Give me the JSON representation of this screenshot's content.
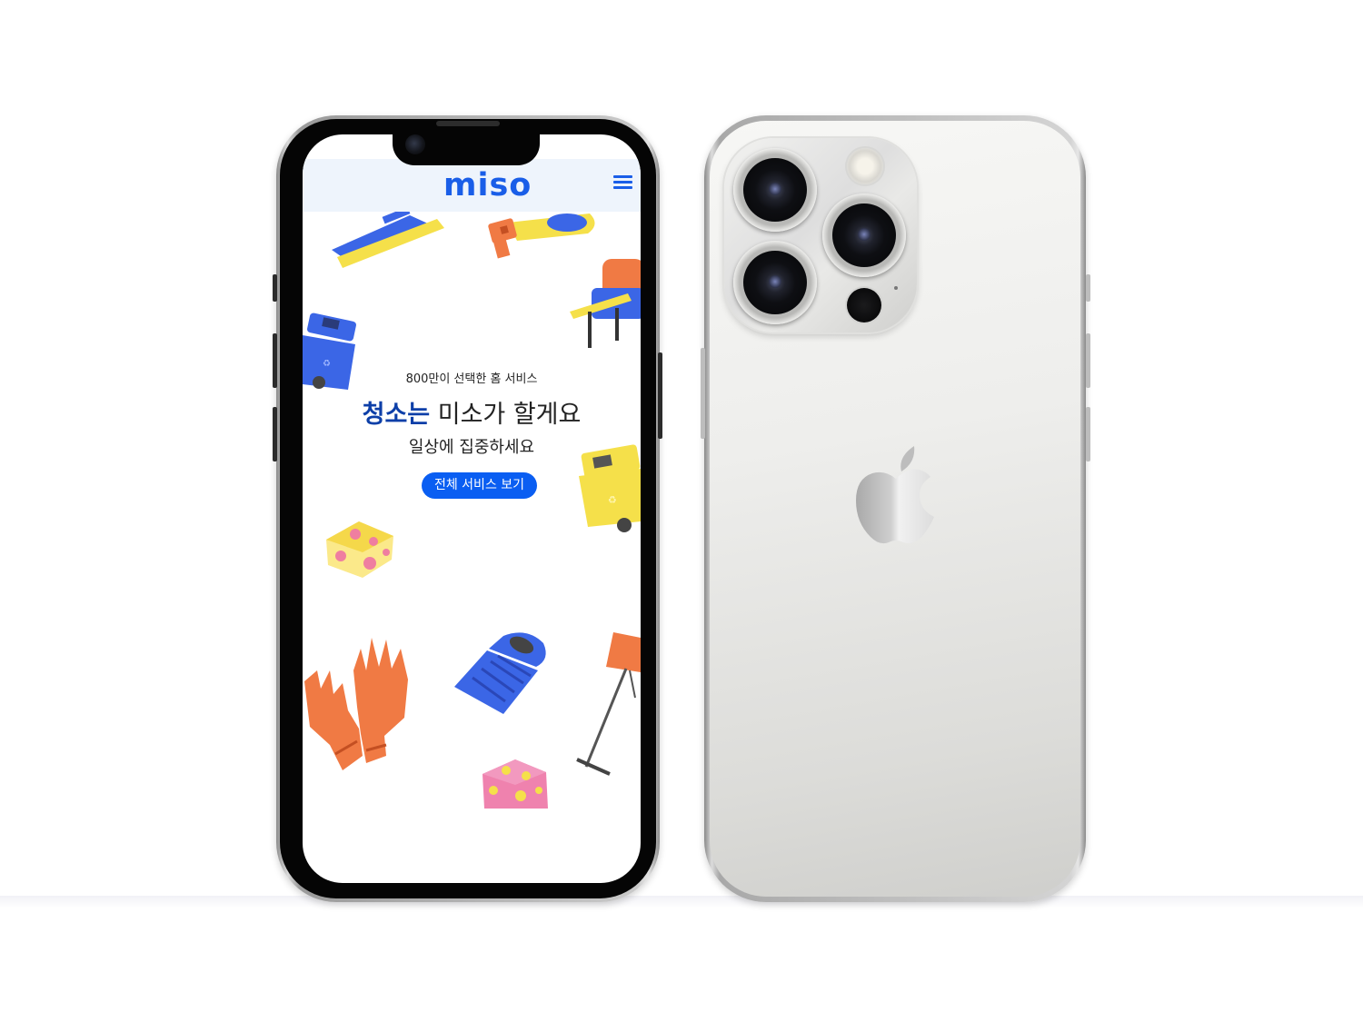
{
  "app": {
    "logo": "miso",
    "menu_icon": "hamburger-menu-icon"
  },
  "hero": {
    "subtitle": "800만이 선택한 홈 서비스",
    "title_highlight": "청소는",
    "title_rest": " 미소가 할게요",
    "description": "일상에 집중하세요",
    "cta_label": "전체 서비스 보기"
  },
  "colors": {
    "brand_blue": "#1a5ee8",
    "title_blue": "#0d3fa8",
    "cta_blue": "#0a5ef2",
    "header_bg": "#eef4fc"
  },
  "illustrations": [
    "mop-icon",
    "spray-gun-icon",
    "armchair-icon",
    "blue-recycle-bin-icon",
    "yellow-recycle-bin-icon",
    "yellow-sponge-icon",
    "rubber-gloves-icon",
    "trash-can-icon",
    "floor-lamp-icon",
    "pink-sponge-icon"
  ],
  "device_back": {
    "logo_icon": "apple-logo-icon"
  }
}
